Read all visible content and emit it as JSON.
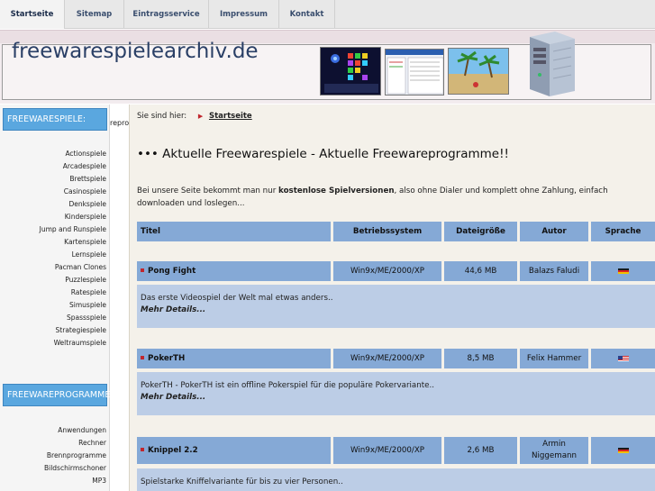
{
  "nav": {
    "items": [
      {
        "label": "Startseite",
        "active": true
      },
      {
        "label": "Sitemap"
      },
      {
        "label": "Eintragsservice"
      },
      {
        "label": "Impressum"
      },
      {
        "label": "Kontakt"
      }
    ]
  },
  "header": {
    "site_title": "freewarespielearchiv.de"
  },
  "sidebar": {
    "section1_title": "FREEWARESPIELE:",
    "section1_items": [
      "Actionspiele",
      "Arcadespiele",
      "Brettspiele",
      "Casinospiele",
      "Denkspiele",
      "Kinderspiele",
      "Jump and Runspiele",
      "Kartenspiele",
      "Lernspiele",
      "Pacman Clones",
      "Puzzlespiele",
      "Ratespiele",
      "Simuspiele",
      "Spassspiele",
      "Strategiespiele",
      "Weltraumspiele"
    ],
    "section2_title": "FREEWAREPROGRAMME:",
    "section2_items": [
      "Anwendungen",
      "Rechner",
      "Brennprogramme",
      "Bildschirmschoner",
      "MP3"
    ],
    "overflow_fragment": "reprog"
  },
  "main": {
    "breadcrumb_label": "Sie sind hier:",
    "breadcrumb_link": "Startseite",
    "heading": "••• Aktuelle Freewarespiele - Aktuelle Freewareprogramme!!",
    "intro_before": "Bei unsere Seite bekommt man nur ",
    "intro_bold": "kostenlose Spielversionen",
    "intro_after": ", also ohne Dialer und komplett ohne Zahlung, einfach downloaden und loslegen...",
    "table_headers": {
      "title": "Titel",
      "os": "Betriebssystem",
      "size": "Dateigröße",
      "author": "Autor",
      "lang": "Sprache"
    },
    "rows": [
      {
        "title": "Pong Fight",
        "os": "Win9x/ME/2000/XP",
        "size": "44,6 MB",
        "author": "Balazs Faludi",
        "lang_flag": "de",
        "desc": "Das erste Videospiel der Welt mal etwas anders..",
        "more": "Mehr Details..."
      },
      {
        "title": "PokerTH",
        "os": "Win9x/ME/2000/XP",
        "size": "8,5 MB",
        "author": "Felix Hammer",
        "lang_flag": "us",
        "desc": "PokerTH - PokerTH ist ein offline Pokerspiel für die populäre Pokervariante..",
        "more": "Mehr Details..."
      },
      {
        "title": "Knippel 2.2",
        "os": "Win9x/ME/2000/XP",
        "size": "2,6 MB",
        "author_line1": "Armin",
        "author_line2": "Niggemann",
        "lang_flag": "de",
        "desc": "Spielstarke Kniffelvariante für bis zu vier Personen..",
        "more": "Mehr Details..."
      }
    ]
  },
  "colors": {
    "nav_bg": "#e8e8e8",
    "sidebar_head": "#5aa7df",
    "table_cell": "#85a9d6",
    "desc_bg": "#bccde6",
    "bullet_red": "#c0262d",
    "title_text": "#2a3f66"
  }
}
